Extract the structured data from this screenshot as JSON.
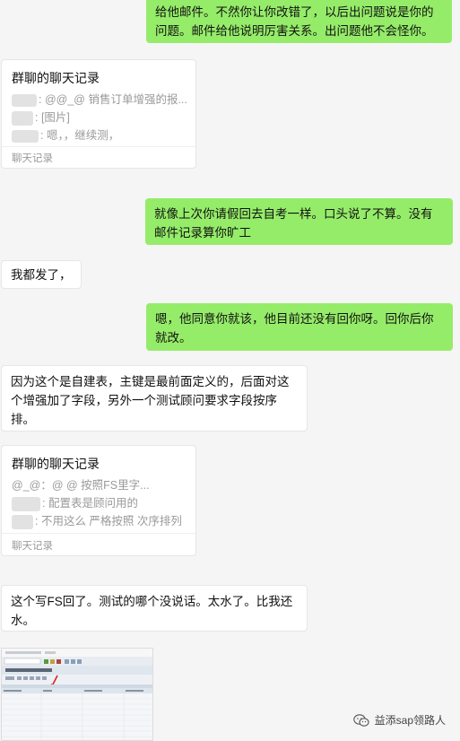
{
  "messages": [
    {
      "id": "m1",
      "text": "给他邮件。不然你让你改错了，以后出问题说是你的问题。邮件给他说明厉害关系。出问题他不会怪你。"
    },
    {
      "id": "m3",
      "text": "就像上次你请假回去自考一样。口头说了不算。没有邮件记录算你旷工"
    },
    {
      "id": "m4",
      "text": "我都发了，"
    },
    {
      "id": "m5",
      "text": "嗯，他同意你就该，他目前还没有回你呀。回你后你就改。"
    },
    {
      "id": "m6",
      "text": "因为这个是自建表，主键是最前面定义的，后面对这个增强加了字段，另外一个测试顾问要求字段按序排。"
    },
    {
      "id": "m8",
      "text": "这个写FS回了。测试的哪个没说话。太水了。比我还水。"
    }
  ],
  "cards": [
    {
      "title": "群聊的聊天记录",
      "lines": [
        ": @@_@  销售订单增强的报...",
        ": [图片]",
        ": 嗯，，继续测，"
      ],
      "footer": "聊天记录"
    },
    {
      "title": "群聊的聊天记录",
      "lines": [
        "@_@：@          @  按照FS里字...",
        ": 配置表是顾问用的",
        ": 不用这么 严格按照 次序排列"
      ],
      "footer": "聊天记录"
    }
  ],
  "watermark": {
    "text": "益添sap领路人",
    "icon": "wechat-icon"
  },
  "screenshot_thumb": {
    "title_text": "维护视图\"自建表名\": 概览"
  },
  "colors": {
    "outgoing_bubble": "#95ec69",
    "incoming_bubble": "#ffffff",
    "background": "#f5f5f5"
  }
}
